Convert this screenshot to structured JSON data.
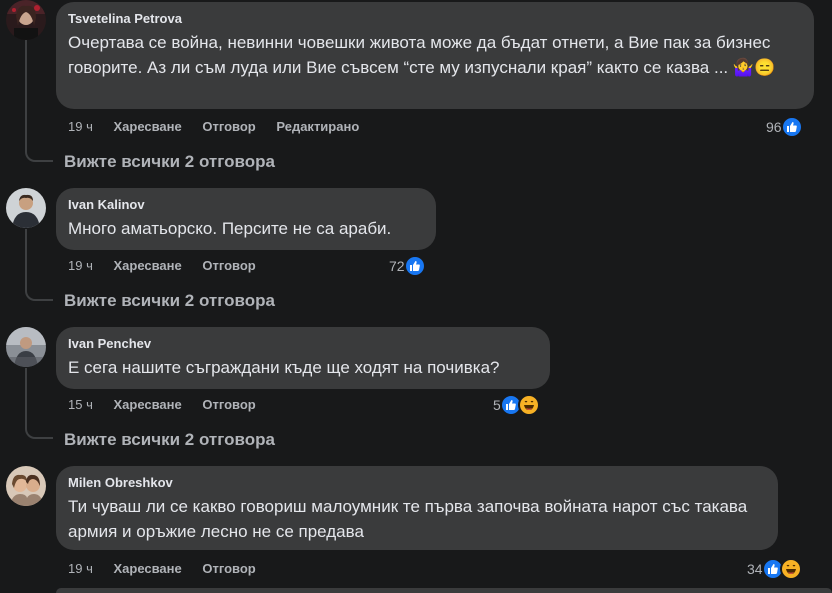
{
  "comments": [
    {
      "author": "Tsvetelina Petrova",
      "text": "Очертава се война, невинни човешки живота може да бъдат отнети, а Вие пак за бизнес говорите. Аз ли съм луда или Вие съвсем “сте му изпуснали края” както се казва ... 🤷‍♀️😑",
      "time": "19 ч",
      "like_label": "Харесване",
      "reply_label": "Отговор",
      "edited_label": "Редактирано",
      "reaction_count": "96",
      "reactions": [
        "like-icon"
      ],
      "view_replies": "Вижте всички 2 отговора"
    },
    {
      "author": "Ivan Kalinov",
      "text": "Много аматьорско. Персите не са араби.",
      "time": "19 ч",
      "like_label": "Харесване",
      "reply_label": "Отговор",
      "reaction_count": "72",
      "reactions": [
        "like-icon"
      ],
      "view_replies": "Вижте всички 2 отговора"
    },
    {
      "author": "Ivan Penchev",
      "text": "Е сега нашите съграждани къде ще ходят на почивка?",
      "time": "15 ч",
      "like_label": "Харесване",
      "reply_label": "Отговор",
      "reaction_count": "5",
      "reactions": [
        "like-icon",
        "haha-icon"
      ],
      "view_replies": "Вижте всички 2 отговора"
    },
    {
      "author": "Milen Obreshkov",
      "text": "Ти чуваш ли се какво говориш малоумник те първа започва войната нарот със такава армия и оръжие лесно не се предава",
      "time": "19 ч",
      "like_label": "Харесване",
      "reply_label": "Отговор",
      "reaction_count": "34",
      "reactions": [
        "like-icon",
        "haha-icon"
      ]
    }
  ],
  "colors": {
    "background": "#18191a",
    "bubble": "#3a3b3c",
    "text": "#e4e6eb",
    "secondary": "#b0b3b8",
    "like_blue": "#1877f2",
    "haha_yellow": "#f7b125"
  }
}
